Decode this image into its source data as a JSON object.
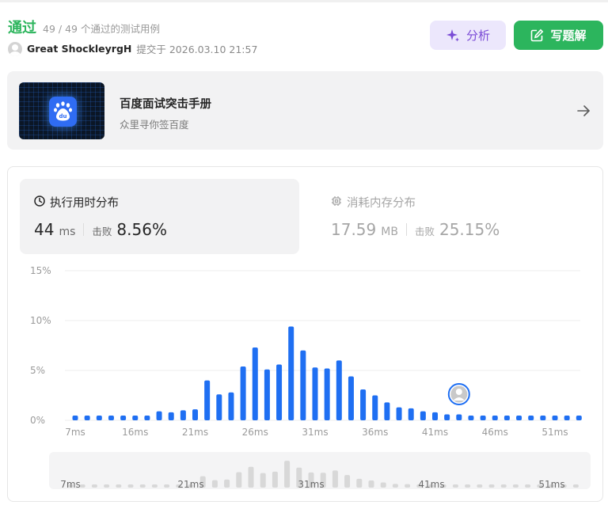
{
  "header": {
    "status": "通过",
    "count_text": "49 / 49 个通过的测试用例",
    "author": "Great ShockleyrgH",
    "submitted_text": "提交于 2026.03.10 21:57",
    "analyze_label": "分析",
    "solution_label": "写题解"
  },
  "promo": {
    "title": "百度面试突击手册",
    "subtitle": "众里寻你签百度",
    "logo_text": "du"
  },
  "runtime": {
    "label": "执行用时分布",
    "value": "44",
    "unit": "ms",
    "beat_label": "击败",
    "beat": "8.56%"
  },
  "memory": {
    "label": "消耗内存分布",
    "value": "17.59",
    "unit": "MB",
    "beat_label": "击败",
    "beat": "25.15%"
  },
  "colors": {
    "accent_green": "#2db55d",
    "bar_blue": "#1f6ff2",
    "analyze_purple": "#7a4bd6",
    "nav_bar_gray": "#d8d8d8"
  },
  "chart_data": {
    "type": "bar",
    "ylabel": "",
    "xlabel": "",
    "ylim": [
      0,
      15
    ],
    "y_ticks": [
      "15%",
      "10%",
      "5%",
      "0%"
    ],
    "x_ticks": [
      "7ms",
      "16ms",
      "21ms",
      "26ms",
      "31ms",
      "36ms",
      "41ms",
      "46ms",
      "51ms"
    ],
    "values": [
      0.4,
      0.4,
      0.4,
      0.4,
      0.4,
      0.4,
      0.4,
      0.9,
      0.8,
      1.0,
      1.1,
      4.0,
      2.6,
      2.8,
      5.4,
      7.3,
      5.1,
      5.6,
      9.4,
      7.0,
      5.3,
      5.2,
      6.0,
      4.4,
      3.1,
      2.5,
      1.8,
      1.3,
      1.2,
      0.9,
      0.8,
      0.6,
      0.6,
      0.4,
      0.4,
      0.4,
      0.4,
      0.4,
      0.4,
      0.4,
      0.4,
      0.4,
      0.4
    ],
    "highlight_index": 32,
    "grid": true,
    "navigator_ticks": [
      "7ms",
      "21ms",
      "31ms",
      "41ms",
      "51ms"
    ]
  }
}
